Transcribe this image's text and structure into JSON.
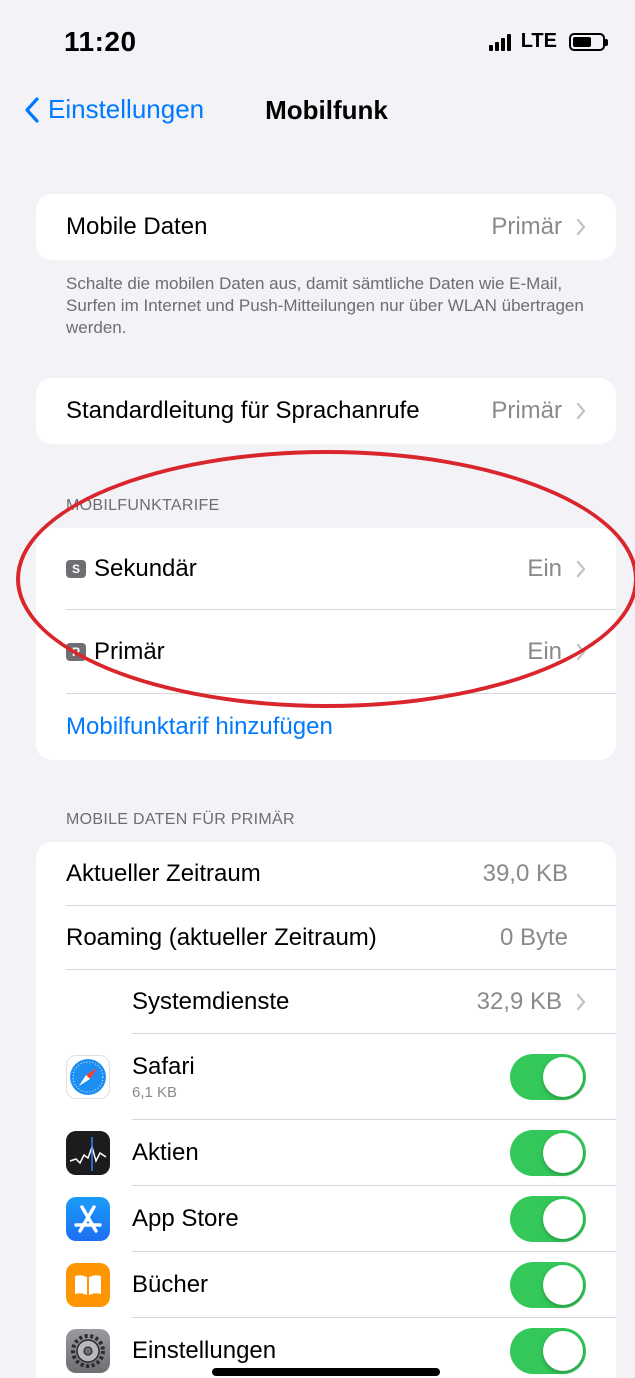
{
  "status_bar": {
    "time": "11:20",
    "network": "LTE"
  },
  "nav": {
    "back_label": "Einstellungen",
    "title": "Mobilfunk"
  },
  "mobile_data": {
    "label": "Mobile Daten",
    "value": "Primär",
    "footnote": "Schalte die mobilen Daten aus, damit sämtliche Daten wie E-Mail, Surfen im Internet und Push-Mitteilungen nur über WLAN übertragen werden."
  },
  "voice": {
    "label": "Standardleitung für Sprachanrufe",
    "value": "Primär"
  },
  "plans": {
    "header": "MOBILFUNKTARIFE",
    "items": [
      {
        "badge": "S",
        "label": "Sekundär",
        "value": "Ein"
      },
      {
        "badge": "P",
        "label": "Primär",
        "value": "Ein"
      }
    ],
    "add_label": "Mobilfunktarif hinzufügen"
  },
  "usage": {
    "header": "MOBILE DATEN FÜR PRIMÄR",
    "current_period": {
      "label": "Aktueller Zeitraum",
      "value": "39,0 KB"
    },
    "roaming": {
      "label": "Roaming (aktueller Zeitraum)",
      "value": "0 Byte"
    },
    "system": {
      "label": "Systemdienste",
      "value": "32,9 KB"
    },
    "apps": [
      {
        "name": "Safari",
        "sub": "6,1 KB",
        "icon": "safari-icon",
        "enabled": true
      },
      {
        "name": "Aktien",
        "sub": "",
        "icon": "stocks-icon",
        "enabled": true
      },
      {
        "name": "App Store",
        "sub": "",
        "icon": "app-store-icon",
        "enabled": true
      },
      {
        "name": "Bücher",
        "sub": "",
        "icon": "books-icon",
        "enabled": true
      },
      {
        "name": "Einstellungen",
        "sub": "",
        "icon": "settings-icon",
        "enabled": true
      }
    ]
  },
  "colors": {
    "accent": "#007aff",
    "toggle_on": "#34c759",
    "annotation": "#d9262c",
    "background": "#f2f2f7"
  }
}
